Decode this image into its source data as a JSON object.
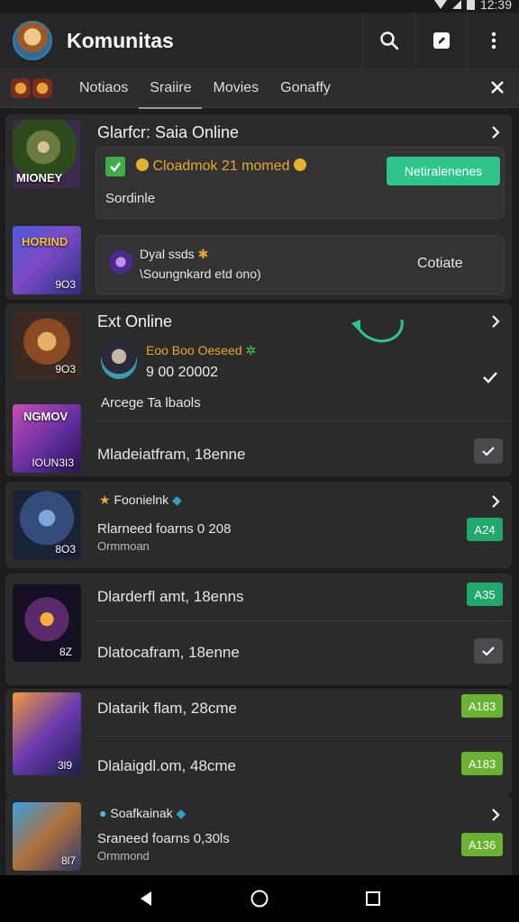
{
  "statusbar": {
    "time": "12:39"
  },
  "appbar": {
    "title": "Komunitas"
  },
  "tabs": {
    "items": [
      {
        "label": "Notiaos"
      },
      {
        "label": "Sraiire"
      },
      {
        "label": "Movies"
      },
      {
        "label": "Gonaffy"
      }
    ],
    "active_index": 1
  },
  "cards": {
    "c1": {
      "title": "Glarfcr: Saia Online",
      "thumb1_caption": "MIONEY",
      "status_text": "Cloadmok 21 momed",
      "status_sub": "Sordinle",
      "action_button": "Netiralenenes",
      "thumb2_caption": "HORIND",
      "thumb2_num": "9O3",
      "notice_title": "Dyal ssds",
      "notice_sub": "\\Soungnkard etd ono)",
      "notice_action": "Cotiate"
    },
    "c2": {
      "title": "Ext Online",
      "thumb1_num": "9O3",
      "profile_name": "Eoo Boo Oeseed",
      "profile_stats": "9 00  20002",
      "description": "Arcege  Ta lbaols",
      "thumb2_caption": "NGMOV",
      "thumb2_num": "IOUN3I3",
      "row_title": "Mladeiatfram, 18enne"
    },
    "c3": {
      "title": "Foonielnk",
      "sub": "Rlarneed foarns  0 208",
      "small": "Ormmoan",
      "thumb_num": "8O3",
      "badge": "A24"
    },
    "c4": {
      "row1": "Dlarderfl amt, 18enns",
      "badge1": "A35",
      "row2": "Dlatocafram, 18enne",
      "thumb_num": "8Z"
    },
    "c5": {
      "row1": "Dlatarik flam, 28cme",
      "badge1": "A183",
      "row2": "Dlalaigdl.om, 48cme",
      "badge2": "A183",
      "thumb_num": "3l9"
    },
    "c6": {
      "title": "Soafkainak",
      "sub": "Sraneed foarns 0,30ls",
      "small": "Ormmond",
      "thumb_num": "8l7",
      "badge": "A136"
    }
  },
  "colors": {
    "accent_green": "#2fc58a",
    "badge_teal": "#22a86b",
    "badge_lime": "#6ab232",
    "background": "#1c1c1e"
  }
}
